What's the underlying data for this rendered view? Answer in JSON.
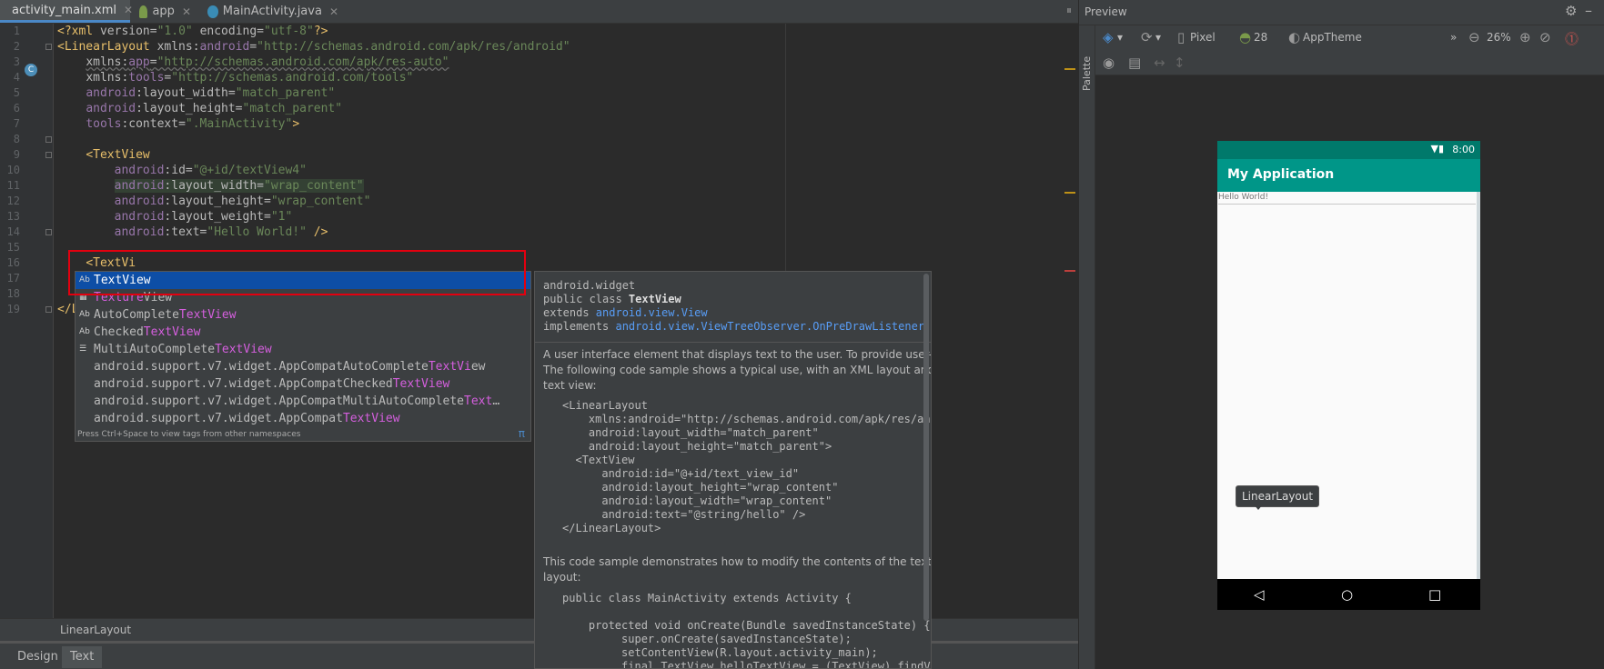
{
  "tabs": [
    {
      "label": "activity_main.xml",
      "icon": "xml-layout-icon",
      "active": true
    },
    {
      "label": "app",
      "icon": "android-module-icon",
      "active": false
    },
    {
      "label": "MainActivity.java",
      "icon": "java-class-icon",
      "active": false
    }
  ],
  "editor": {
    "line_numbers": [
      "1",
      "2",
      "3",
      "4",
      "5",
      "6",
      "7",
      "8",
      "9",
      "10",
      "11",
      "12",
      "13",
      "14",
      "15",
      "16",
      "17",
      "18",
      "19"
    ],
    "typed_text": "<TextVi"
  },
  "completion": {
    "items": [
      {
        "icon": "Ab",
        "prefix": "",
        "match": "TextView",
        "suffix": ""
      },
      {
        "icon": "texture",
        "prefix": "",
        "match": "Texture",
        "suffix": "View"
      },
      {
        "icon": "Ab",
        "prefix": "AutoComplete",
        "match": "TextView",
        "suffix": ""
      },
      {
        "icon": "Ab",
        "prefix": "Checked",
        "match": "TextView",
        "suffix": ""
      },
      {
        "icon": "list",
        "prefix": "MultiAutoComplete",
        "match": "TextView",
        "suffix": ""
      },
      {
        "icon": "",
        "prefix": "android.support.v7.widget.AppCompatAutoComplete",
        "match": "TextVi",
        "suffix": "ew"
      },
      {
        "icon": "",
        "prefix": "android.support.v7.widget.AppCompatChecked",
        "match": "TextView",
        "suffix": ""
      },
      {
        "icon": "",
        "prefix": "android.support.v7.widget.AppCompatMultiAutoComplete",
        "match": "Text",
        "suffix": "…"
      },
      {
        "icon": "",
        "prefix": "android.support.v7.widget.AppCompat",
        "match": "TextView",
        "suffix": ""
      }
    ],
    "hint": "Press Ctrl+Space to view tags from other namespaces",
    "pi": "π"
  },
  "doc": {
    "package": "android.widget",
    "declaration_prefix": "public class ",
    "class_name": "TextView",
    "extends_prefix": "extends ",
    "extends_class": "android.view.View",
    "implements_prefix": "implements ",
    "implements_class": "android.view.ViewTreeObserver.OnPreDrawListener",
    "desc1": "A user interface element that displays text to the user. To provide user-editable",
    "desc2": "The following code sample shows a typical use, with an XML layout and code t",
    "desc3": "text view:",
    "sample1": [
      "<LinearLayout",
      "    xmlns:android=\"http://schemas.android.com/apk/res/andr",
      "    android:layout_width=\"match_parent\"",
      "    android:layout_height=\"match_parent\">",
      "  <TextView",
      "      android:id=\"@+id/text_view_id\"",
      "      android:layout_height=\"wrap_content\"",
      "      android:layout_width=\"wrap_content\"",
      "      android:text=\"@string/hello\" />",
      "</LinearLayout>"
    ],
    "desc4": "This code sample demonstrates how to modify the contents of the text view de",
    "desc5": "layout:",
    "sample2": [
      "public class MainActivity extends Activity {",
      "",
      "    protected void onCreate(Bundle savedInstanceState) {",
      "         super.onCreate(savedInstanceState);",
      "         setContentView(R.layout.activity_main);",
      "         final TextView helloTextView = (TextView) findView"
    ]
  },
  "breadcrumb": "LinearLayout",
  "bottom_tabs": [
    {
      "label": "Design",
      "active": false
    },
    {
      "label": "Text",
      "active": true
    }
  ],
  "preview": {
    "title": "Preview",
    "palette_label": "Palette",
    "device": "Pixel",
    "api": "28",
    "theme": "AppTheme",
    "zoom": "26%",
    "clock": "8:00",
    "app_title": "My Application",
    "hello_text": "Hello World!",
    "tooltip": "LinearLayout"
  },
  "colors": {
    "status_bar": "#00796b",
    "app_bar": "#009688",
    "selection": "#0d4ea6",
    "highlight_box": "#e3000f"
  }
}
